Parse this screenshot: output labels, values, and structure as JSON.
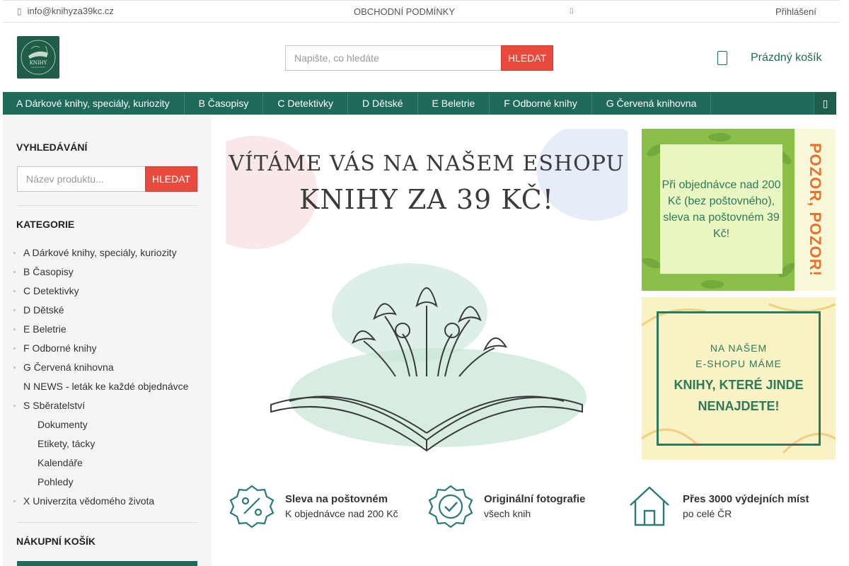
{
  "topbar": {
    "email_icon": "envelope-icon",
    "email": "info@knihyza39kc.cz",
    "terms": "OBCHODNÍ PODMÍNKY",
    "tiny_icon": "social-icon",
    "login": "Přihlášení"
  },
  "header": {
    "logo_alt": "KNIHY",
    "search_placeholder": "Napište, co hledáte",
    "search_button": "HLEDAT",
    "cart_label": "Prázdný košík"
  },
  "nav": {
    "items": [
      "A Dárkové knihy, speciály, kuriozity",
      "B Časopisy",
      "C Detektivky",
      "D Dětské",
      "E Beletrie",
      "F Odborné knihy",
      "G Červená knihovna"
    ],
    "end_icon": "menu-more-icon"
  },
  "sidebar": {
    "search_heading": "VYHLEDÁVÁNÍ",
    "search_placeholder": "Název produktu...",
    "search_button": "HLEDAT",
    "categories_heading": "KATEGORIE",
    "categories": [
      {
        "label": "A Dárkové knihy, speciály, kuriozity",
        "level": 0,
        "bullet": true
      },
      {
        "label": "B Časopisy",
        "level": 0,
        "bullet": true
      },
      {
        "label": "C Detektivky",
        "level": 0,
        "bullet": true
      },
      {
        "label": "D Dětské",
        "level": 0,
        "bullet": true
      },
      {
        "label": "E Beletrie",
        "level": 0,
        "bullet": true
      },
      {
        "label": "F Odborné knihy",
        "level": 0,
        "bullet": true
      },
      {
        "label": "G Červená knihovna",
        "level": 0,
        "bullet": true
      },
      {
        "label": "N NEWS - leták ke každé objednávce",
        "level": 0,
        "bullet": false
      },
      {
        "label": "S Sběratelství",
        "level": 0,
        "bullet": true
      },
      {
        "label": "Dokumenty",
        "level": 1,
        "bullet": false
      },
      {
        "label": "Etikety, tácky",
        "level": 1,
        "bullet": false
      },
      {
        "label": "Kalendáře",
        "level": 1,
        "bullet": false
      },
      {
        "label": "Pohledy",
        "level": 1,
        "bullet": false
      },
      {
        "label": "X Univerzita vědomého života",
        "level": 0,
        "bullet": true
      }
    ],
    "cart_heading": "NÁKUPNÍ KOŠÍK"
  },
  "hero": {
    "line1": "VÍTÁME VÁS NA NAŠEM ESHOPU",
    "line2": "KNIHY ZA 39 KČ!"
  },
  "banner_green": {
    "text": "Při objednávce nad 200 Kč (bez poštovného), sleva na poštovném 39 Kč!",
    "side": "POZOR, POZOR!"
  },
  "banner_yellow": {
    "line1": "NA NAŠEM",
    "line2": "E-SHOPU MÁME",
    "line3": "KNIHY, KTERÉ JINDE",
    "line4": "NENAJDETE!"
  },
  "features": [
    {
      "icon": "percent-badge-icon",
      "title": "Sleva na poštovném",
      "subtitle": "K objednávce nad 200 Kč"
    },
    {
      "icon": "check-badge-icon",
      "title": "Originální fotografie",
      "subtitle": "všech knih"
    },
    {
      "icon": "house-icon",
      "title": "Přes 3000 výdejních míst",
      "subtitle": "po celé ČR"
    }
  ],
  "colors": {
    "brand_green": "#1f6a58",
    "accent_red": "#e84b3e",
    "sidebar_bg": "#f5f5f5"
  }
}
